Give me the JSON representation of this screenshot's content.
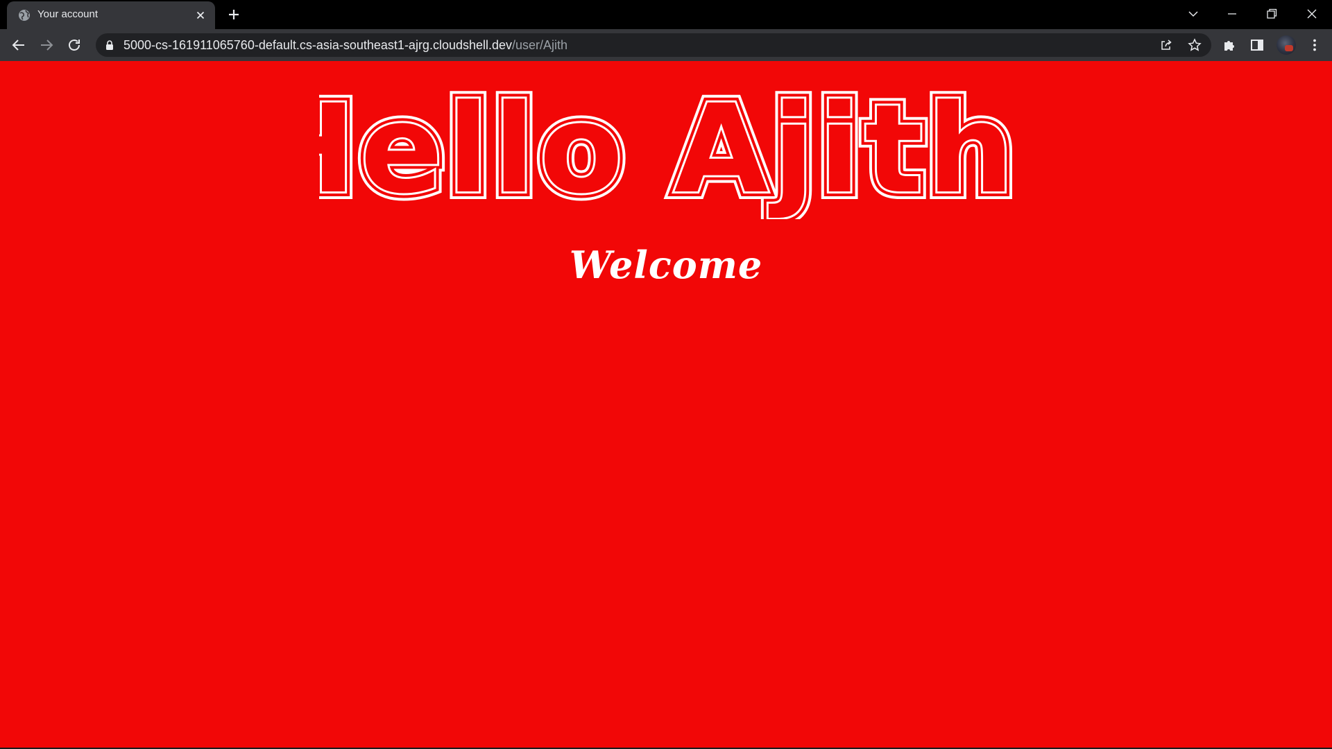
{
  "browser": {
    "tab": {
      "title": "Your account",
      "favicon": "globe-icon",
      "close_icon": "close-icon"
    },
    "new_tab_icon": "plus-icon",
    "window_controls": [
      "chevron-down-icon",
      "minimize-icon",
      "restore-icon",
      "close-icon"
    ],
    "toolbar": {
      "back_icon": "arrow-left-icon",
      "forward_icon": "arrow-right-icon",
      "reload_icon": "reload-icon",
      "url_host": "5000-cs-161911065760-default.cs-asia-southeast1-ajrg.cloudshell.dev",
      "url_path": "/user/Ajith",
      "lock_icon": "lock-icon",
      "share_icon": "share-icon",
      "bookmark_icon": "star-icon",
      "extensions_icon": "puzzle-icon",
      "side_panel_icon": "side-panel-icon",
      "profile_icon": "avatar",
      "menu_icon": "kebab-menu-icon"
    }
  },
  "page": {
    "background_color": "#f20707",
    "headline": "Hello Ajith!",
    "subheading": "Welcome"
  },
  "colors": {
    "tabstrip": "#000000",
    "toolbar": "#35363a",
    "omnibox": "#202124",
    "text_light": "#e8eaed",
    "text_muted": "#9aa0a6"
  }
}
